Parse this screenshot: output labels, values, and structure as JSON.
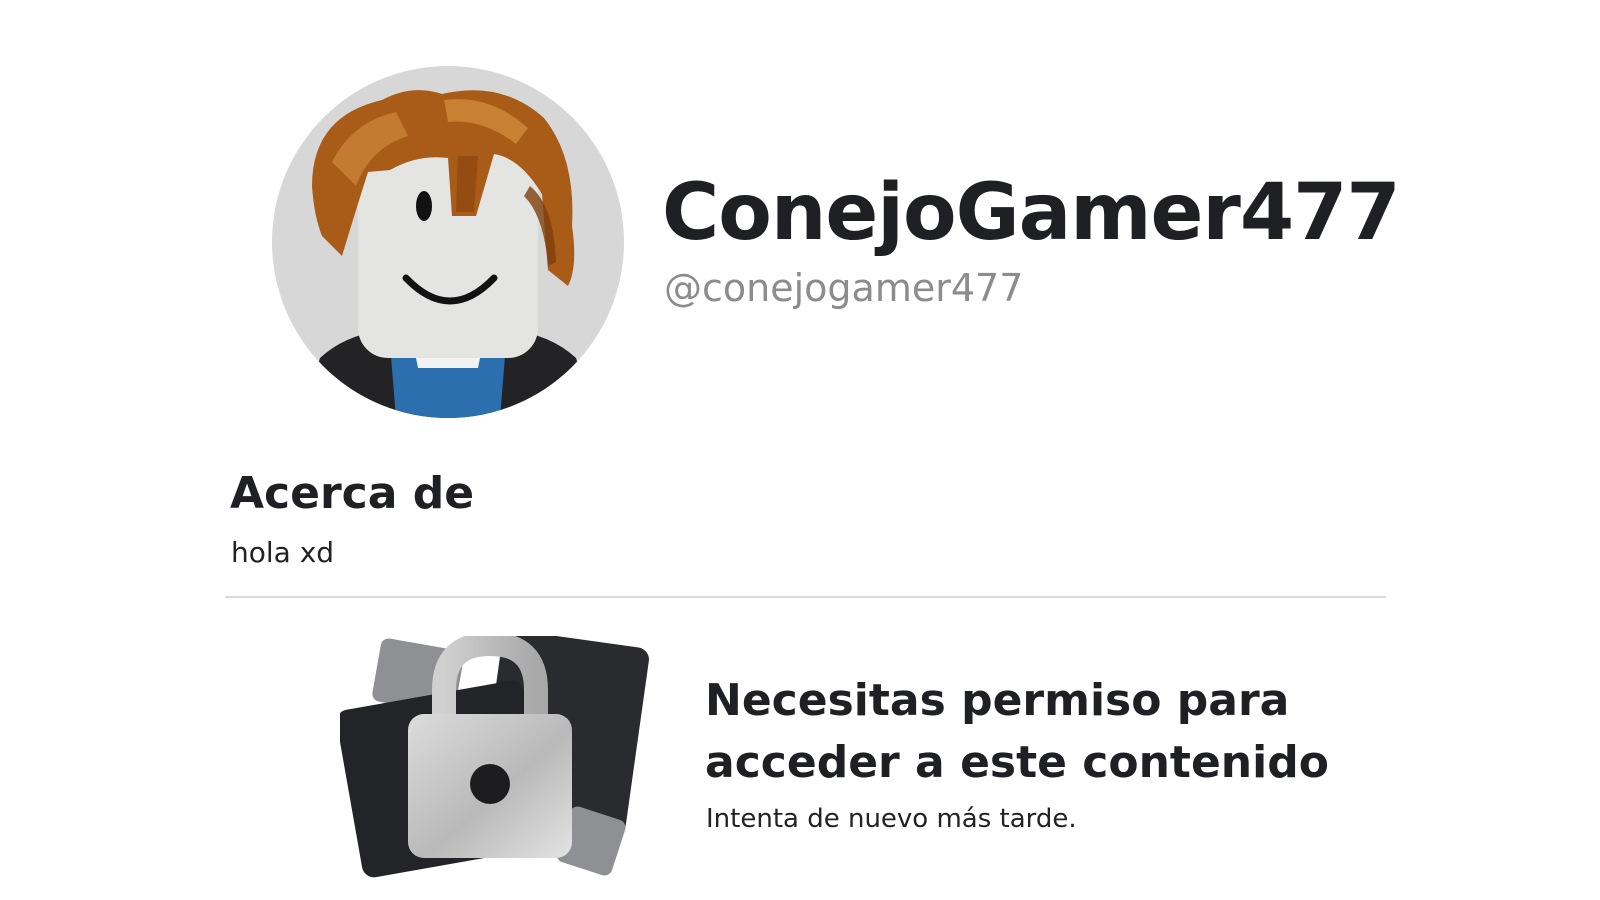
{
  "profile": {
    "display_name": "ConejoGamer477",
    "username": "@conejogamer477"
  },
  "about": {
    "title": "Acerca de",
    "text": "hola xd"
  },
  "restricted": {
    "title_line1": "Necesitas permiso para",
    "title_line2": "acceder a este contenido",
    "subtitle": "Intenta de nuevo más tarde."
  },
  "icons": {
    "avatar": "avatar-icon",
    "lock": "lock-icon"
  },
  "colors": {
    "text": "#1f2023",
    "muted": "#8a8c90",
    "avatar_bg": "#d7d7d7",
    "divider": "#d9dadc"
  }
}
